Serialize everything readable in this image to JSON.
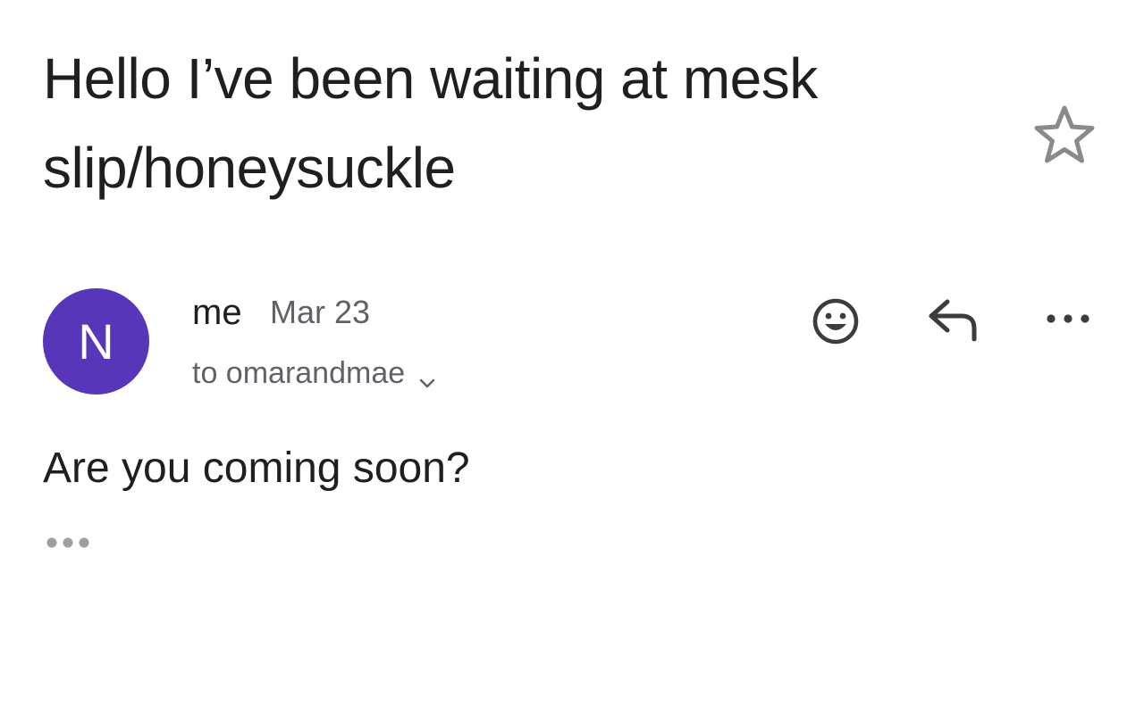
{
  "email": {
    "subject_lines": [
      "Hello I’ve been waiting at mesk",
      "slip/honeysuckle"
    ],
    "starred": false,
    "sender": {
      "avatar_letter": "N",
      "avatar_color": "#5736b9",
      "name": "me",
      "date": "Mar 23",
      "recipient_line": "to omarandmae"
    },
    "body": "Are you coming soon?",
    "actions": {
      "icons": [
        "add-reaction-icon",
        "reply-icon",
        "more-options-icon"
      ]
    },
    "trimmed_content_icon": "ellipsis-icon"
  },
  "colors": {
    "text_primary": "#1f1f1f",
    "text_secondary": "#5f6368",
    "icon_gray": "#8a8a8a"
  }
}
